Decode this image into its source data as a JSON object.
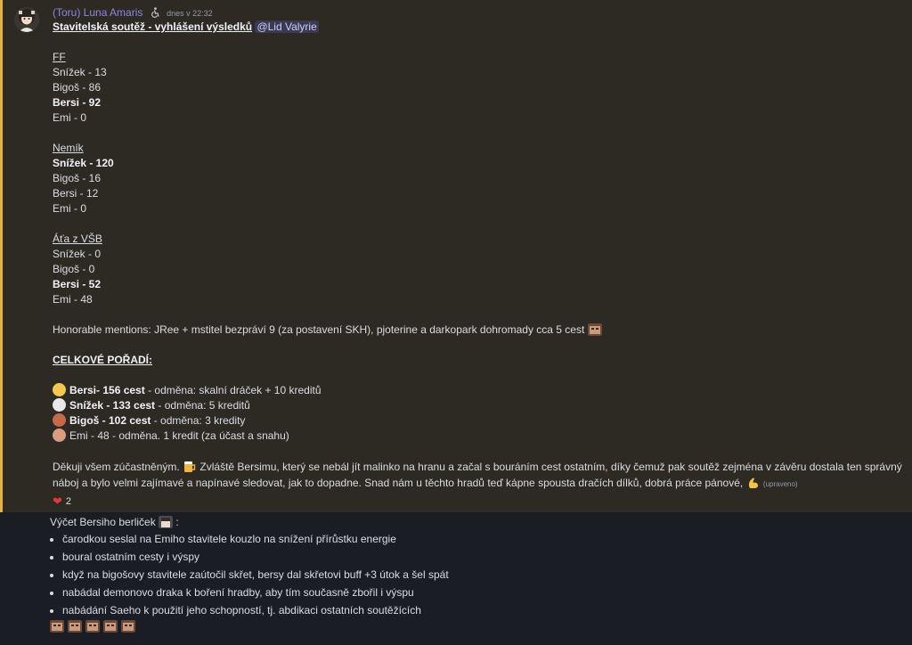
{
  "message1": {
    "username": "(Toru) Luna Amaris",
    "timestamp": "dnes v 22:32",
    "title": "Stavitelská soutěž - vyhlášení výsledků",
    "mention": "@Lid Valyrie",
    "sections": [
      {
        "heading": "FF",
        "rows": [
          {
            "text": "Snížek - 13",
            "bold": false
          },
          {
            "text": "Bigoš - 86",
            "bold": false
          },
          {
            "text": "Bersi - 92",
            "bold": true
          },
          {
            "text": "Emi - 0",
            "bold": false
          }
        ]
      },
      {
        "heading": "Nemík",
        "rows": [
          {
            "text": "Snížek - 120",
            "bold": true
          },
          {
            "text": "Bigoš - 16",
            "bold": false
          },
          {
            "text": "Bersi - 12",
            "bold": false
          },
          {
            "text": "Emi - 0",
            "bold": false
          }
        ]
      },
      {
        "heading": "Áťa z VŠB",
        "rows": [
          {
            "text": "Snížek - 0",
            "bold": false
          },
          {
            "text": "Bigoš - 0",
            "bold": false
          },
          {
            "text": "Bersi - 52",
            "bold": true
          },
          {
            "text": "Emi - 48",
            "bold": false
          }
        ]
      }
    ],
    "honorable": "Honorable mentions: JRee + mstitel bezpráví 9 (za postavení SKH), pjoterine a darkopark dohromady cca 5 cest",
    "overall_heading": "CELKOVÉ POŘADÍ:",
    "ranking": [
      {
        "name": "Bersi- 156 cest",
        "reward": " - odměna: skalní dráček + 10 kreditů",
        "bold": true
      },
      {
        "name": "Snížek - 133 cest",
        "reward": " - odměna: 5 kreditů",
        "bold": true
      },
      {
        "name": "Bigoš - 102 cest",
        "reward": " - odměna: 3 kredity",
        "bold": true
      },
      {
        "name": "Emi - 48 - odměna. 1 kredit (za účast a snahu)",
        "reward": "",
        "bold": false
      }
    ],
    "medal_colors": [
      "#f2c94c",
      "#e8e8e8",
      "#c46a4a",
      "#d99e82"
    ],
    "thanks_a": "Děkuji všem zúčastněným.",
    "thanks_b": "Zvláště Bersimu, který se nebál jít malinko na hranu a začal s bouráním cest ostatním, díky čemuž pak soutěž zejména v závěru dostala ten správný náboj a bylo velmi zajímavé a napínavé sledovat, jak to dopadne. Snad nám u těchto hradů teď kápne spousta dračích dílků, dobrá práce pánové,",
    "edited": "(upraveno)",
    "reaction_count": "2",
    "accent_color": "#e6b43a"
  },
  "message2": {
    "intro": "Výčet Bersiho berliček",
    "intro_suffix": ":",
    "items": [
      "čarodkou seslal na Emiho stavitele kouzlo na snížení přírůstku energie",
      "boural ostatním cesty i výspy",
      "když na bigošovy stavitele zaútočil skřet, bersy dal skřetovi buff +3 útok a šel spát",
      "nabádal demonovo draka k boření hradby, aby tím současně zbořil i výspu",
      "nabádání Saeho k použití jeho schopností, tj. abdikaci ostatních soutěžících"
    ],
    "emoji_count": 5
  }
}
